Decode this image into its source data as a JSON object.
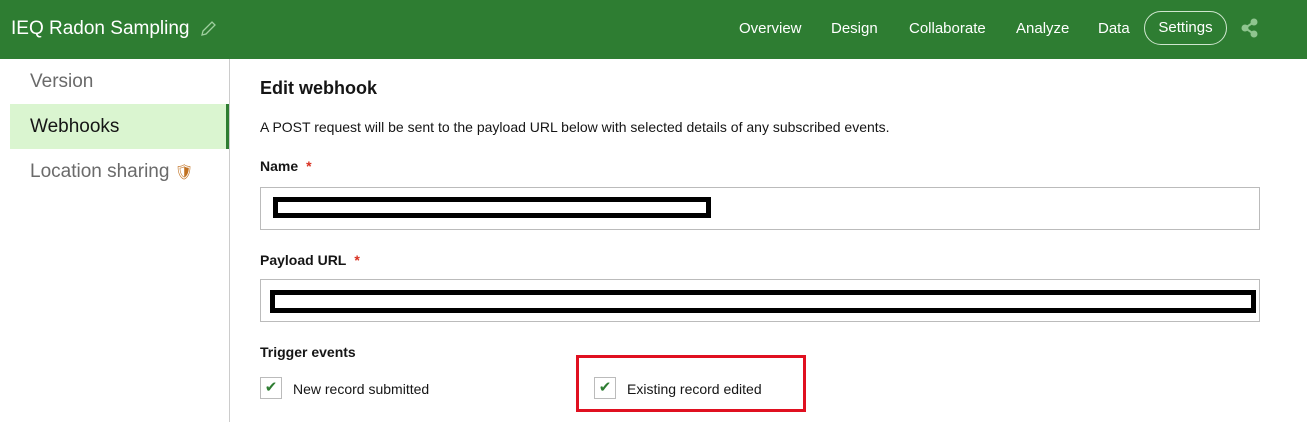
{
  "header": {
    "title": "IEQ Radon Sampling",
    "nav": [
      "Overview",
      "Design",
      "Collaborate",
      "Analyze",
      "Data"
    ],
    "settings": "Settings"
  },
  "sidebar": {
    "items": [
      "Version",
      "Webhooks",
      "Location sharing"
    ]
  },
  "main": {
    "heading": "Edit webhook",
    "description": "A POST request will be sent to the payload URL below with selected details of any subscribed events.",
    "name_label": "Name",
    "payload_label": "Payload URL",
    "required": "*",
    "trigger_label": "Trigger events",
    "events": [
      {
        "label": "New record submitted",
        "checked": true
      },
      {
        "label": "Existing record edited",
        "checked": true
      }
    ]
  }
}
